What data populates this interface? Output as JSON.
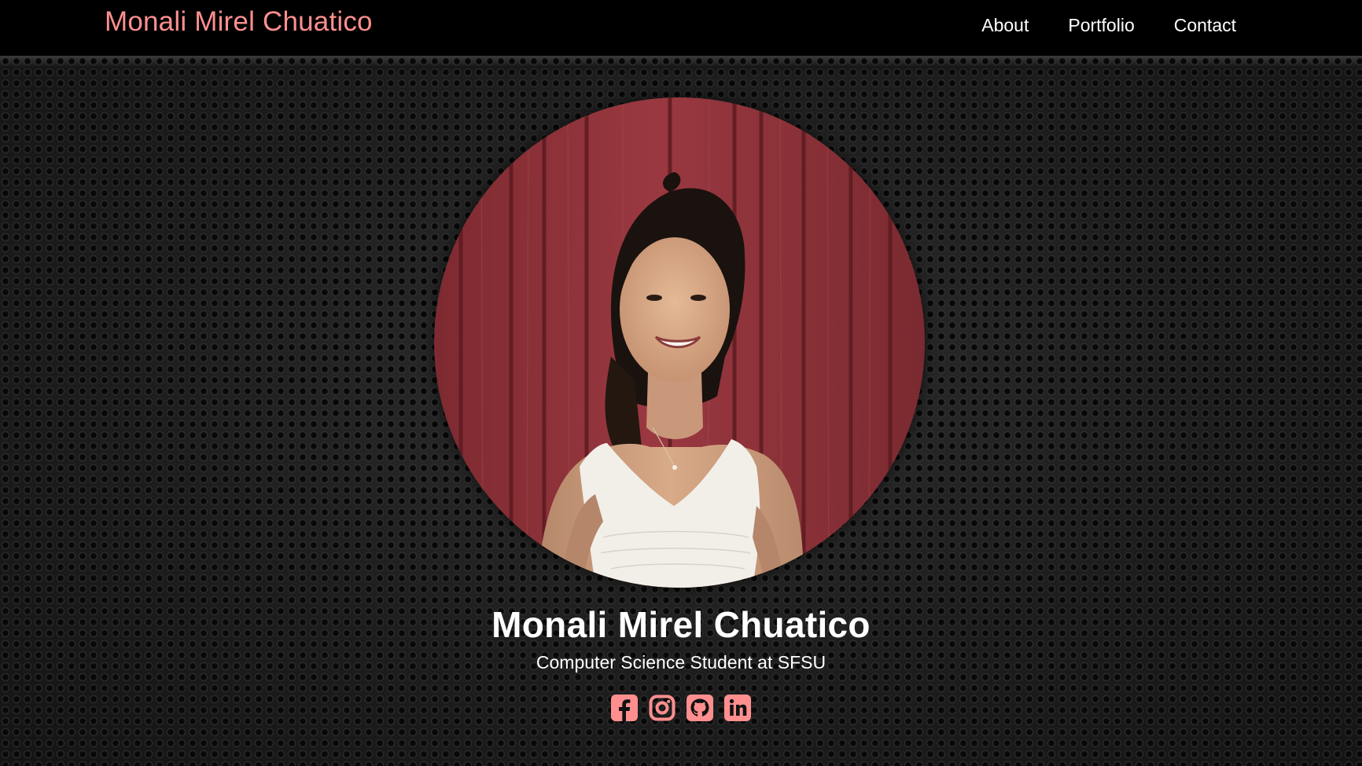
{
  "brand": "Monali Mirel Chuatico",
  "nav": {
    "about": "About",
    "portfolio": "Portfolio",
    "contact": "Contact"
  },
  "hero": {
    "name": "Monali Mirel Chuatico",
    "subtitle": "Computer Science Student at SFSU"
  },
  "social": [
    {
      "icon": "facebook-square-icon"
    },
    {
      "icon": "instagram-icon"
    },
    {
      "icon": "github-icon"
    },
    {
      "icon": "linkedin-icon"
    }
  ],
  "colors": {
    "accent": "#ff8f8f",
    "navbar": "#000000",
    "text": "#ffffff"
  }
}
